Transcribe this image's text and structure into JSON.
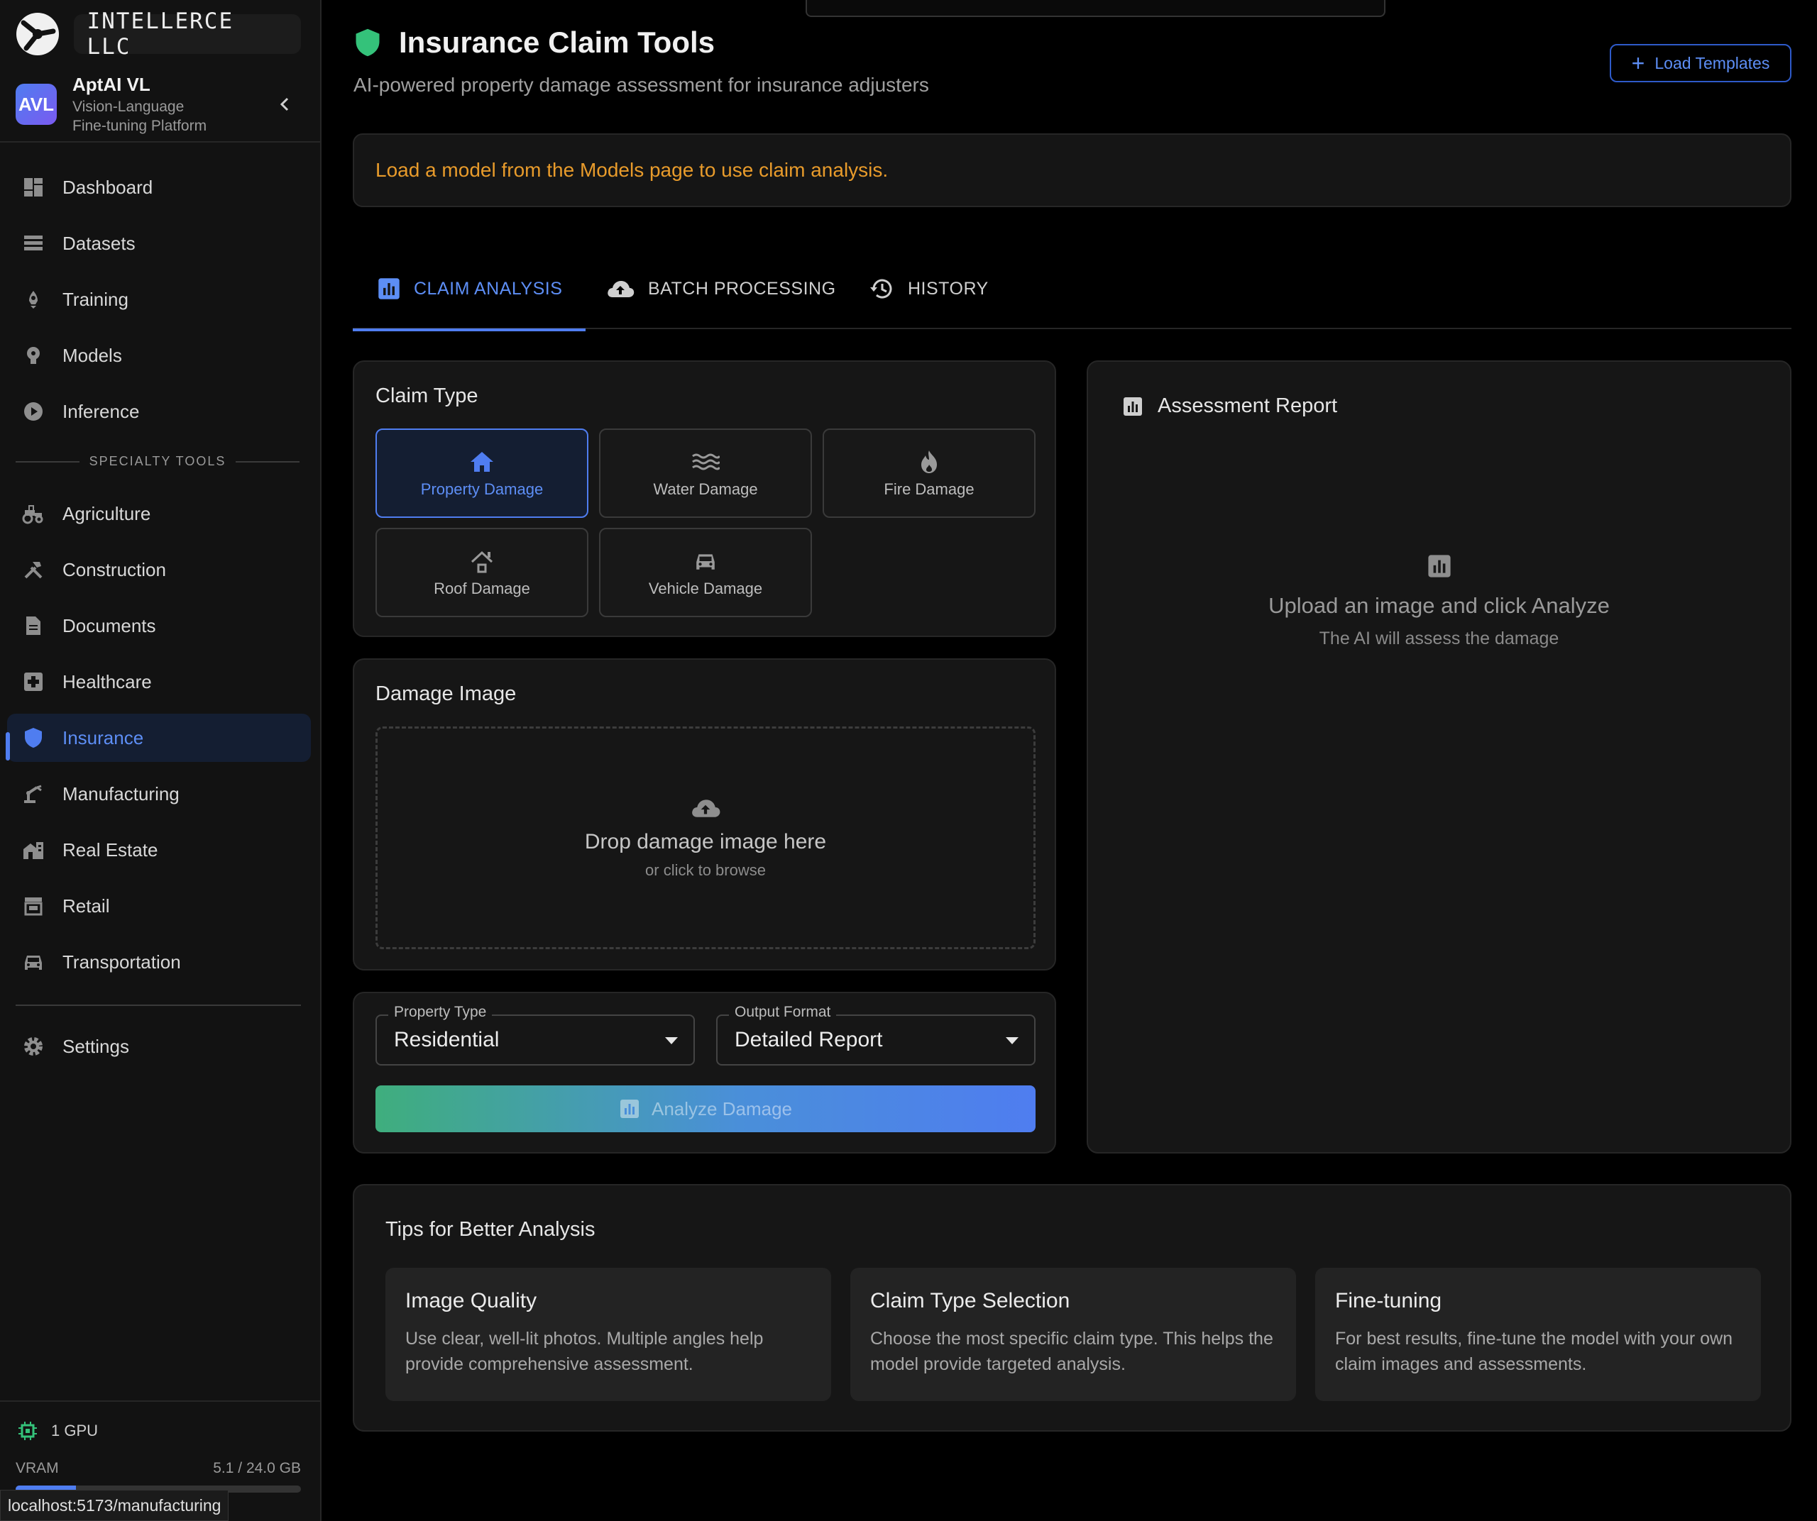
{
  "brand": {
    "name": "INTELLERCE LLC"
  },
  "profile": {
    "initials": "AVL",
    "name": "AptAI VL",
    "subtitle_line1": "Vision-Language",
    "subtitle_line2": "Fine-tuning Platform"
  },
  "nav": {
    "main": [
      {
        "label": "Dashboard",
        "icon": "dashboard-icon"
      },
      {
        "label": "Datasets",
        "icon": "datasets-icon"
      },
      {
        "label": "Training",
        "icon": "training-icon"
      },
      {
        "label": "Models",
        "icon": "models-icon"
      },
      {
        "label": "Inference",
        "icon": "inference-icon"
      }
    ],
    "section_label": "SPECIALTY TOOLS",
    "specialty": [
      {
        "label": "Agriculture",
        "icon": "tractor-icon"
      },
      {
        "label": "Construction",
        "icon": "construction-icon"
      },
      {
        "label": "Documents",
        "icon": "document-icon"
      },
      {
        "label": "Healthcare",
        "icon": "medical-icon"
      },
      {
        "label": "Insurance",
        "icon": "shield-icon",
        "active": true
      },
      {
        "label": "Manufacturing",
        "icon": "robot-arm-icon"
      },
      {
        "label": "Real Estate",
        "icon": "real-estate-icon"
      },
      {
        "label": "Retail",
        "icon": "store-icon"
      },
      {
        "label": "Transportation",
        "icon": "car-icon"
      }
    ],
    "settings": {
      "label": "Settings",
      "icon": "gear-icon"
    }
  },
  "system": {
    "gpu_label": "1 GPU",
    "vram_label": "VRAM",
    "vram_value": "5.1 / 24.0 GB",
    "vram_fraction": 0.2125
  },
  "status_bar": {
    "url": "localhost:5173/manufacturing"
  },
  "header": {
    "title": "Insurance Claim Tools",
    "subtitle": "AI-powered property damage assessment for insurance adjusters",
    "load_templates": "Load Templates"
  },
  "alert": {
    "text": "Load a model from the Models page to use claim analysis."
  },
  "tabs": [
    {
      "label": "CLAIM ANALYSIS",
      "icon": "chart-icon",
      "active": true
    },
    {
      "label": "BATCH PROCESSING",
      "icon": "cloud-upload-icon"
    },
    {
      "label": "HISTORY",
      "icon": "history-icon"
    }
  ],
  "claim_type": {
    "title": "Claim Type",
    "options": [
      {
        "label": "Property Damage",
        "icon": "home-icon",
        "selected": true
      },
      {
        "label": "Water Damage",
        "icon": "water-icon"
      },
      {
        "label": "Fire Damage",
        "icon": "fire-icon"
      },
      {
        "label": "Roof Damage",
        "icon": "roof-icon"
      },
      {
        "label": "Vehicle Damage",
        "icon": "car-icon"
      }
    ]
  },
  "damage_image": {
    "title": "Damage Image",
    "drop_title": "Drop damage image here",
    "drop_sub": "or click to browse"
  },
  "form": {
    "property_type": {
      "label": "Property Type",
      "value": "Residential"
    },
    "output_format": {
      "label": "Output Format",
      "value": "Detailed Report"
    },
    "analyze_label": "Analyze Damage"
  },
  "report": {
    "title": "Assessment Report",
    "empty_title": "Upload an image and click Analyze",
    "empty_sub": "The AI will assess the damage"
  },
  "tips": {
    "title": "Tips for Better Analysis",
    "items": [
      {
        "title": "Image Quality",
        "body": "Use clear, well-lit photos. Multiple angles help provide comprehensive assessment."
      },
      {
        "title": "Claim Type Selection",
        "body": "Choose the most specific claim type. This helps the model provide targeted analysis."
      },
      {
        "title": "Fine-tuning",
        "body": "For best results, fine-tune the model with your own claim images and assessments."
      }
    ]
  },
  "colors": {
    "accent": "#4f7df0",
    "warning": "#e89b2b",
    "shield": "#34c27a",
    "gpu": "#34c27a"
  }
}
